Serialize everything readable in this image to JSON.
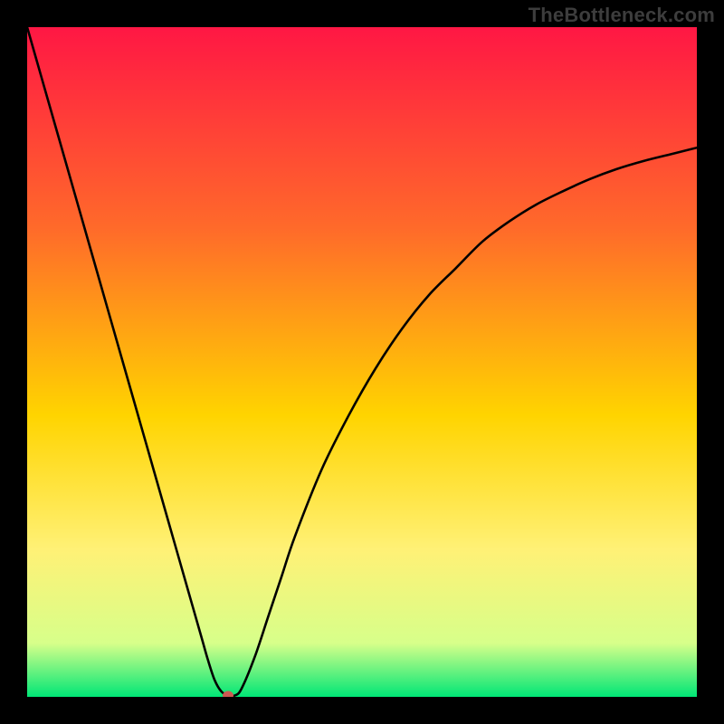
{
  "watermark": "TheBottleneck.com",
  "colors": {
    "frame_bg": "#000000",
    "gradient_top": "#ff1744",
    "gradient_mid_upper": "#ff6a2a",
    "gradient_mid": "#ffd400",
    "gradient_mid_lower": "#fff176",
    "gradient_near_bottom": "#d7ff8a",
    "gradient_bottom": "#00e676",
    "curve": "#000000",
    "marker": "#cc5a52"
  },
  "chart_data": {
    "type": "line",
    "title": "",
    "xlabel": "",
    "ylabel": "",
    "xlim": [
      0,
      100
    ],
    "ylim": [
      0,
      100
    ],
    "x": [
      0,
      2,
      4,
      6,
      8,
      10,
      12,
      14,
      16,
      18,
      20,
      22,
      24,
      26,
      27,
      28,
      29,
      30,
      31,
      32,
      34,
      36,
      38,
      40,
      44,
      48,
      52,
      56,
      60,
      64,
      68,
      72,
      76,
      80,
      84,
      88,
      92,
      96,
      100
    ],
    "values": [
      100,
      93,
      86,
      79,
      72,
      65,
      58,
      51,
      44,
      37,
      30,
      23,
      16,
      9,
      5.5,
      2.5,
      0.8,
      0.2,
      0.2,
      1.2,
      6,
      12,
      18,
      24,
      34,
      42,
      49,
      55,
      60,
      64,
      68,
      71,
      73.5,
      75.5,
      77.3,
      78.8,
      80,
      81,
      82
    ],
    "marker": {
      "x": 30,
      "y": 0.2
    },
    "notes": "Values read approximately from image; curve is a V-shape with minimum near x≈30 where the marker sits on the green band."
  }
}
